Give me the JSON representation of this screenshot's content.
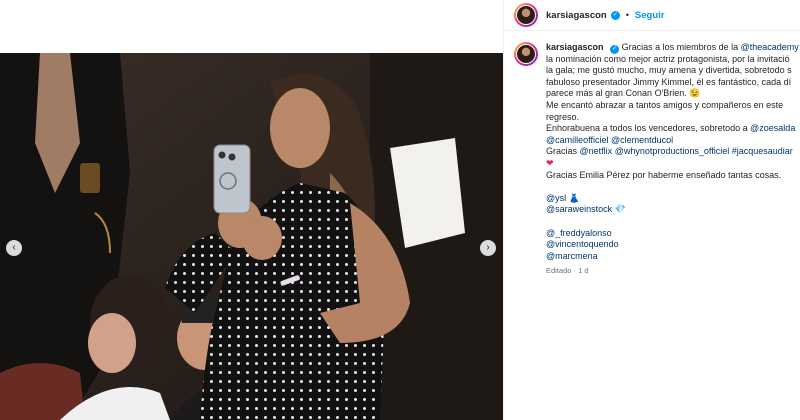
{
  "profile": {
    "username": "karsiagascon",
    "separator": "•",
    "follow_label": "Seguir"
  },
  "caption": {
    "username": "karsiagascon",
    "lines": [
      "Gracias a los miembros de la ",
      "@theacademy",
      " p",
      "la nominación como mejor actriz protagonista, por la invitació",
      "la gala; me gustó mucho, muy amena y divertida, sobretodo s",
      "fabuloso presentador Jimmy Kimmel, él es fantástico, cada dí",
      "parece más al gran Conan O'Brien. 😉",
      "Me encantó abrazar a tantos amigos y compañeros en este",
      "regreso.",
      "Enhorabuena a todos los vencedores, sobretodo a ",
      "@zoesalda",
      "@camilleofficiel",
      "@clementducol",
      "Gracias ",
      "@netflix",
      "@whynotproductions_officiel",
      "#jacquesaudiar",
      "❤",
      "Gracias Emilia Pérez por haberme enseñado tantas cosas.",
      "@ysl",
      "👗",
      "@saraweinstock",
      "💎",
      "@_freddyalonso",
      "@vincentoquendo",
      "@marcmena"
    ],
    "meta": "Editado · 1 d"
  },
  "media": {
    "prev_glyph": "‹",
    "next_glyph": "›"
  }
}
